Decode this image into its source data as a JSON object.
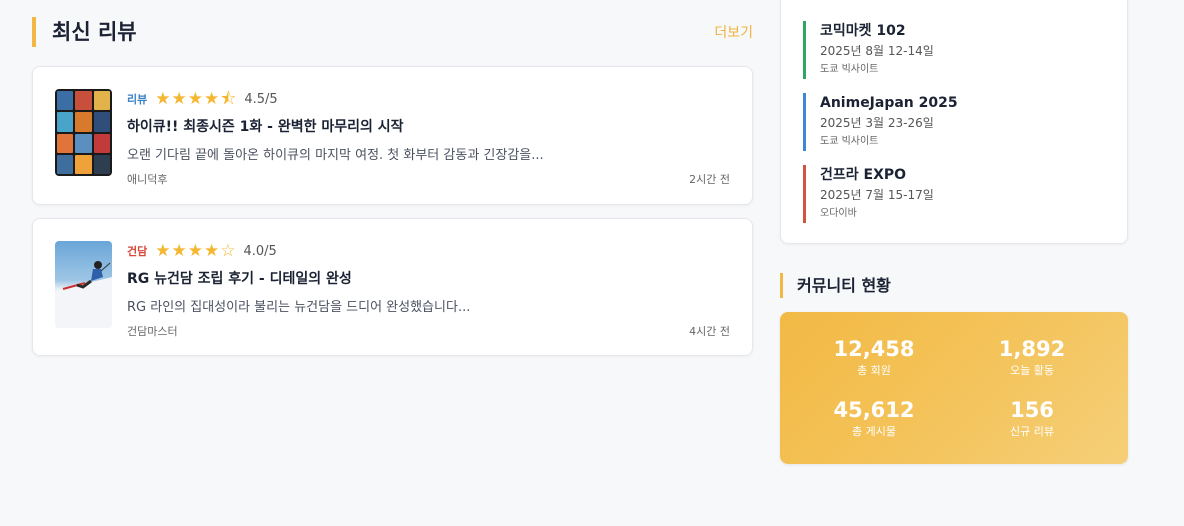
{
  "reviews": {
    "title": "최신 리뷰",
    "more_label": "더보기",
    "items": [
      {
        "category": "리뷰",
        "category_color": "#3b82c4",
        "rating": 4.5,
        "stars": [
          "★",
          "★",
          "★",
          "★",
          "⯪"
        ],
        "rating_text": "4.5/5",
        "title": "하이큐!! 최종시즌 1화 - 완벽한 마무리의 시작",
        "excerpt": "오랜 기다림 끝에 돌아온 하이큐의 마지막 여정. 첫 화부터 감동과 긴장감을...",
        "author": "애니덕후",
        "time": "2시간 전"
      },
      {
        "category": "건담",
        "category_color": "#d9463a",
        "rating": 4.0,
        "stars": [
          "★",
          "★",
          "★",
          "★",
          "☆"
        ],
        "rating_text": "4.0/5",
        "title": "RG 뉴건담 조립 후기 - 디테일의 완성",
        "excerpt": "RG 라인의 집대성이라 불리는 뉴건담을 드디어 완성했습니다...",
        "author": "건담마스터",
        "time": "4시간 전"
      }
    ]
  },
  "events": [
    {
      "name": "코믹마켓 102",
      "date": "2025년 8월 12-14일",
      "venue": "도쿄 빅사이트",
      "color": "#2ea861"
    },
    {
      "name": "AnimeJapan 2025",
      "date": "2025년 3월 23-26일",
      "venue": "도쿄 빅사이트",
      "color": "#3f86d6"
    },
    {
      "name": "건프라 EXPO",
      "date": "2025년 7월 15-17일",
      "venue": "오다이바",
      "color": "#d45340"
    }
  ],
  "community": {
    "title": "커뮤니티 현황",
    "stats": [
      {
        "value": "12,458",
        "label": "총 회원"
      },
      {
        "value": "1,892",
        "label": "오늘 활동"
      },
      {
        "value": "45,612",
        "label": "총 게시물"
      },
      {
        "value": "156",
        "label": "신규 리뷰"
      }
    ],
    "accent": "#f2b744"
  }
}
